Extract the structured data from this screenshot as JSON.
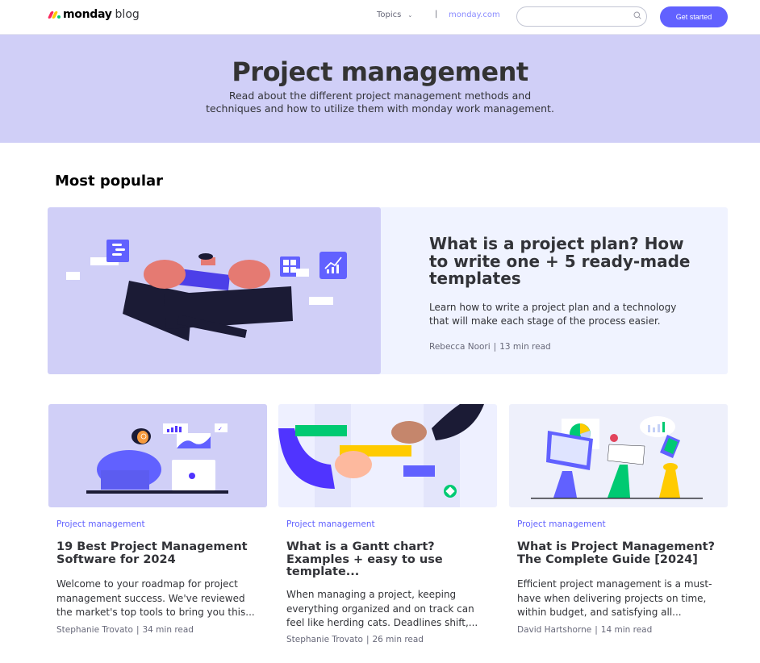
{
  "header": {
    "logo_text": "monday",
    "logo_suffix": "blog",
    "nav_topics": "Topics",
    "nav_separator": "|",
    "nav_link": "monday.com",
    "search_placeholder": "",
    "cta_label": "Get started"
  },
  "hero": {
    "title": "Project management",
    "description": "Read about the different project management methods and techniques and how to utilize them with monday work management."
  },
  "section": {
    "title": "Most popular"
  },
  "featured": {
    "title": "What is a project plan? How to write one + 5 ready-made templates",
    "description": "Learn how to write a project plan and a technology that will make each stage of the process easier.",
    "author": "Rebecca Noori",
    "read_time": "13 min read"
  },
  "articles": [
    {
      "category": "Project management",
      "title": "19 Best Project Management Software for 2024",
      "description": "Welcome to your roadmap for project management success. We've reviewed the market's top tools to bring you this...",
      "author": "Stephanie Trovato",
      "read_time": "34 min read"
    },
    {
      "category": "Project management",
      "title": "What is a Gantt chart? Examples + easy to use template...",
      "description": "When managing a project, keeping everything organized and on track can feel like herding cats. Deadlines shift,...",
      "author": "Stephanie Trovato",
      "read_time": "26 min read"
    },
    {
      "category": "Project management",
      "title": "What is Project Management? The Complete Guide [2024]",
      "description": "Efficient project management is a must-have when delivering projects on time, within budget, and satisfying all...",
      "author": "David Hartshorne",
      "read_time": "14 min read"
    }
  ],
  "meta_separator": "|",
  "colors": {
    "brand": "#6161ff",
    "hero_bg": "#d0cff7",
    "featured_bg": "#f0f3ff"
  }
}
